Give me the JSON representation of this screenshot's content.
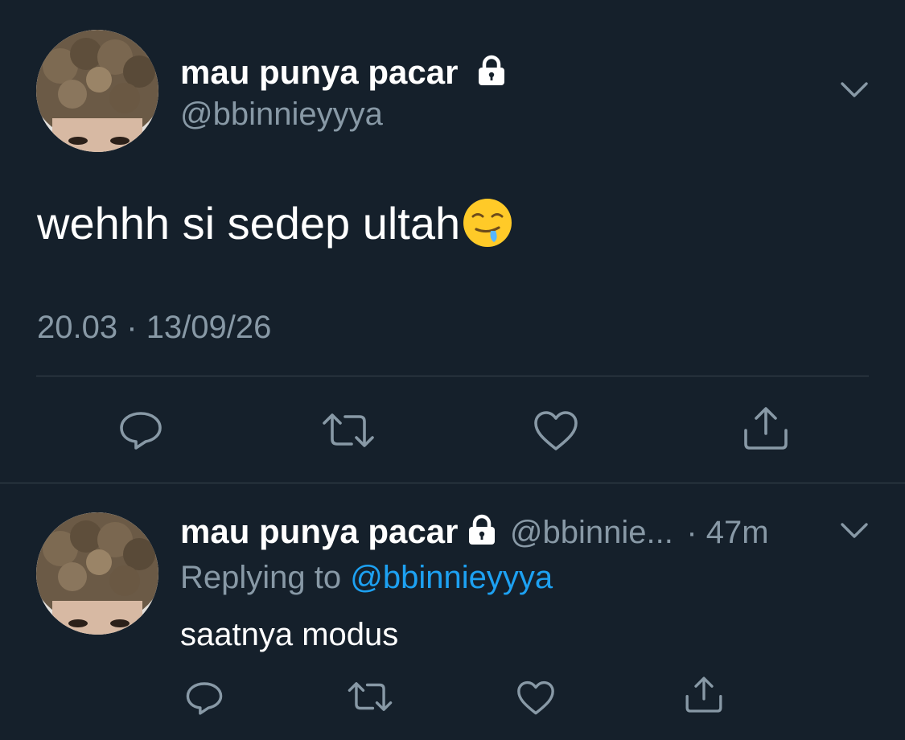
{
  "main_tweet": {
    "display_name": "mau punya pacar",
    "handle": "@bbinnieyyya",
    "text": "wehhh si sedep ultah",
    "emoji": "drooling-face",
    "time": "20.03",
    "separator": "·",
    "date": "13/09/26",
    "actions": [
      "reply",
      "retweet",
      "like",
      "share"
    ]
  },
  "reply_tweet": {
    "display_name": "mau punya pacar",
    "handle": "@bbinnie...",
    "time_ago": "· 47m",
    "replying_prefix": "Replying to",
    "replying_to": "@bbinnieyyya",
    "text": "saatnya modus",
    "actions": [
      "reply",
      "retweet",
      "like",
      "share"
    ]
  },
  "colors": {
    "background": "#15202b",
    "primary_text": "#ffffff",
    "secondary_text": "#8899a6",
    "link": "#1da1f2",
    "divider": "#38444d"
  }
}
